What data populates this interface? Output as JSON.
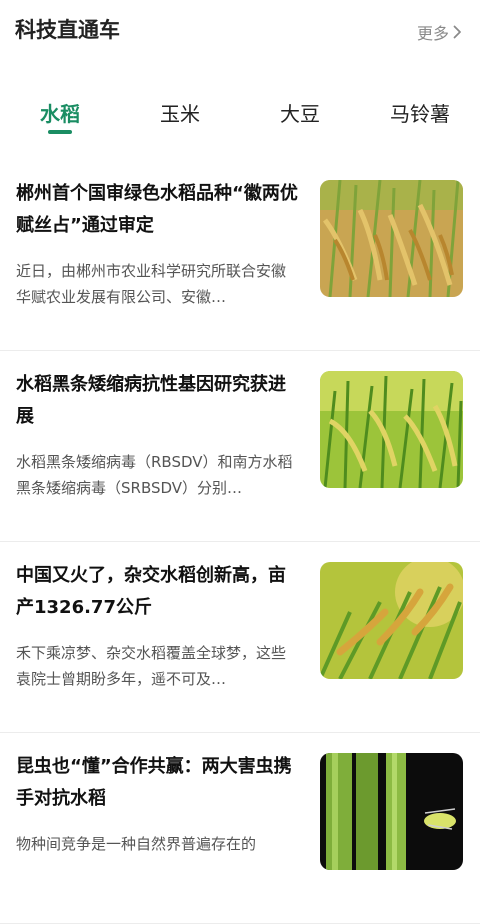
{
  "header": {
    "title": "科技直通车",
    "more_label": "更多"
  },
  "tabs": [
    {
      "label": "水稻",
      "active": true
    },
    {
      "label": "玉米",
      "active": false
    },
    {
      "label": "大豆",
      "active": false
    },
    {
      "label": "马铃薯",
      "active": false
    }
  ],
  "articles": [
    {
      "headline": "郴州首个国审绿色水稻品种“徽两优赋丝占”通过审定",
      "summary": "近日，由郴州市农业科学研究所联合安徽华赋农业发展有限公司、安徽…",
      "image": "rice-paddy-photo"
    },
    {
      "headline": "水稻黑条矮缩病抗性基因研究获进展",
      "summary": "水稻黑条矮缩病毒（RBSDV）和南方水稻黑条矮缩病毒（SRBSDV）分别…",
      "image": "rice-field-photo"
    },
    {
      "headline": "中国又火了，杂交水稻创新高，亩产1326.77公斤",
      "summary": "禾下乘凉梦、杂交水稻覆盖全球梦，这些袁院士曾期盼多年，遥不可及…",
      "image": "rice-ears-photo"
    },
    {
      "headline": "昆虫也“懂”合作共赢：两大害虫携手对抗水稻",
      "summary": "物种间竞争是一种自然界普遍存在的",
      "image": "rice-stems-insect-photo"
    }
  ],
  "colors": {
    "accent": "#1a8d63",
    "muted": "#8a8a8a"
  }
}
